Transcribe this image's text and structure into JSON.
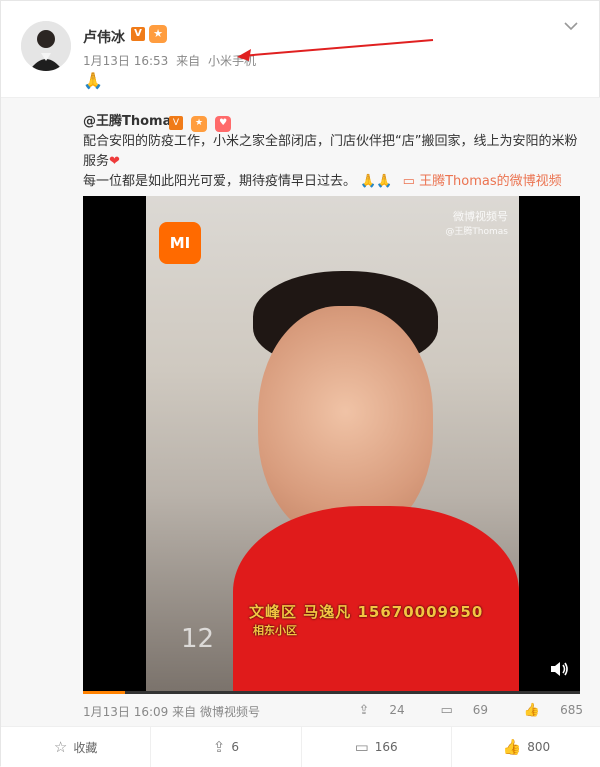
{
  "author": {
    "name": "卢伟冰",
    "verified": "V",
    "badge": "★"
  },
  "post": {
    "date": "1月13日 16:53",
    "source_prefix": "来自",
    "source": "小米手机",
    "text": "🙏"
  },
  "repost": {
    "author": "@王腾Thomas",
    "text_1": "配合安阳的防疫工作，小米之家全部闭店，门店伙伴把“店”搬回家，线上为安阳的米粉服务",
    "heart": "❤",
    "text_2": "每一位都是如此阳光可爱，期待疫情早日过去。",
    "pray": "🙏🙏",
    "video_link": "王腾Thomas的微博视频",
    "video": {
      "logo": "MI",
      "watermark_title": "微博视频号",
      "watermark_sub": "@王腾Thomas",
      "caption_main": "文峰区  马逸凡 15670009950",
      "caption_sub": "相东小区",
      "corner_number": "12",
      "progress": 0.085
    },
    "date": "1月13日 16:09",
    "source_prefix": "来自",
    "source": "微博视频号",
    "reposts": "24",
    "comments": "69",
    "likes": "685"
  },
  "actions": {
    "favorite": "收藏",
    "repost": "6",
    "comment": "166",
    "like": "800"
  }
}
